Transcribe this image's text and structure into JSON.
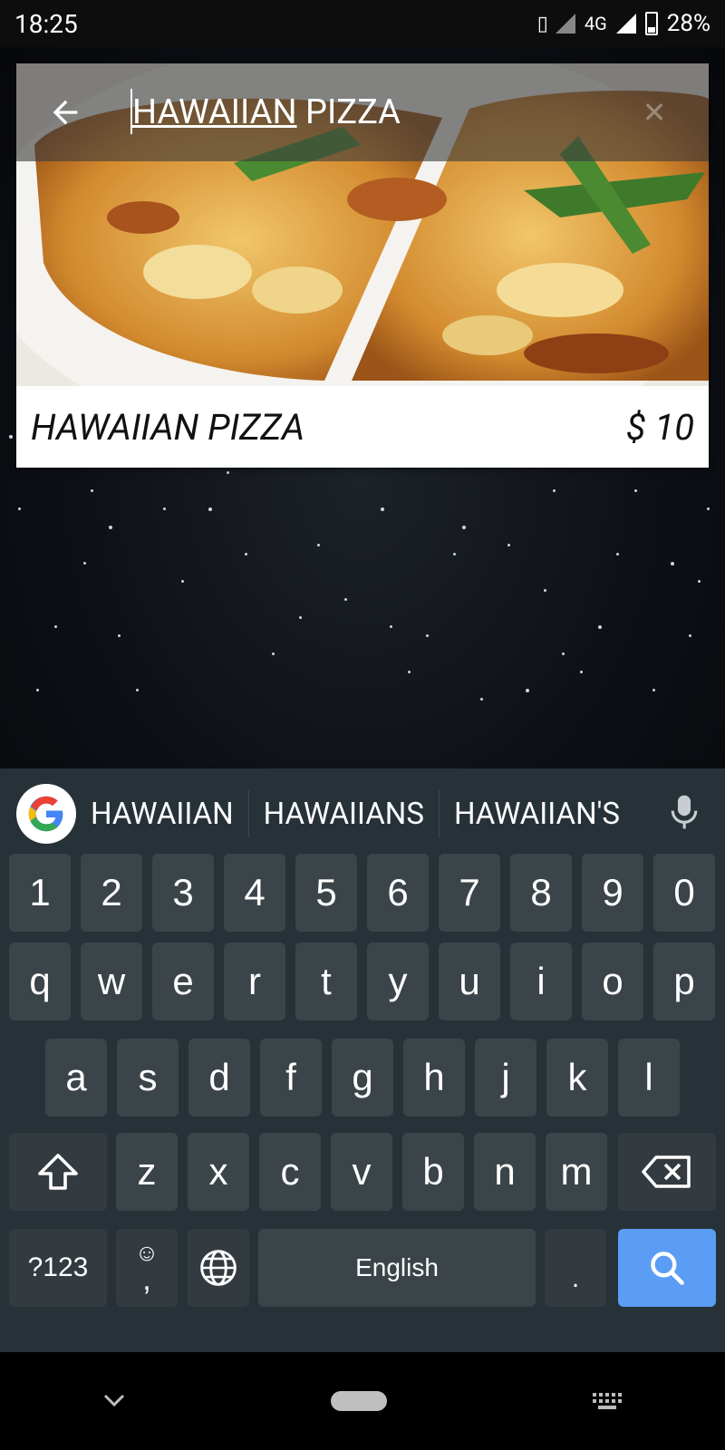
{
  "status_bar": {
    "time": "18:25",
    "network": "4G",
    "battery": "28%"
  },
  "search": {
    "query_part1": "HAWAIIAN",
    "query_part2": " PIZZA",
    "back_icon": "arrow-left-icon",
    "clear_icon": "close-icon"
  },
  "result": {
    "name": "HAWAIIAN PIZZA",
    "price": "$ 10"
  },
  "keyboard": {
    "suggestions": [
      "HAWAIIAN",
      "HAWAIIANS",
      "HAWAIIAN'S"
    ],
    "row_numbers": [
      "1",
      "2",
      "3",
      "4",
      "5",
      "6",
      "7",
      "8",
      "9",
      "0"
    ],
    "row_q": [
      "q",
      "w",
      "e",
      "r",
      "t",
      "y",
      "u",
      "i",
      "o",
      "p"
    ],
    "row_a": [
      "a",
      "s",
      "d",
      "f",
      "g",
      "h",
      "j",
      "k",
      "l"
    ],
    "row_z": [
      "z",
      "x",
      "c",
      "v",
      "b",
      "n",
      "m"
    ],
    "symbols_label": "?123",
    "comma_label": ",",
    "space_label": "English",
    "period_label": ".",
    "action_color": "#5b9cf4"
  }
}
